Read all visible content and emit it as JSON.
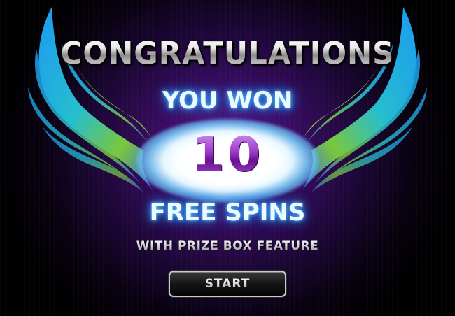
{
  "popup": {
    "title": "CONGRATULATIONS",
    "subtitle": "YOU WON",
    "spins_count": "10",
    "prize_label": "FREE SPINS",
    "feature_label": "WITH PRIZE BOX FEATURE",
    "start_label": "START"
  },
  "icons": {
    "left_wing": "wing-icon",
    "right_wing": "wing-icon"
  },
  "colors": {
    "background": "#3a0d63",
    "glow": "#4fc3ff",
    "number": "#7a1a9e",
    "wing_blue": "#1e8fff",
    "wing_green": "#7fd23c"
  }
}
